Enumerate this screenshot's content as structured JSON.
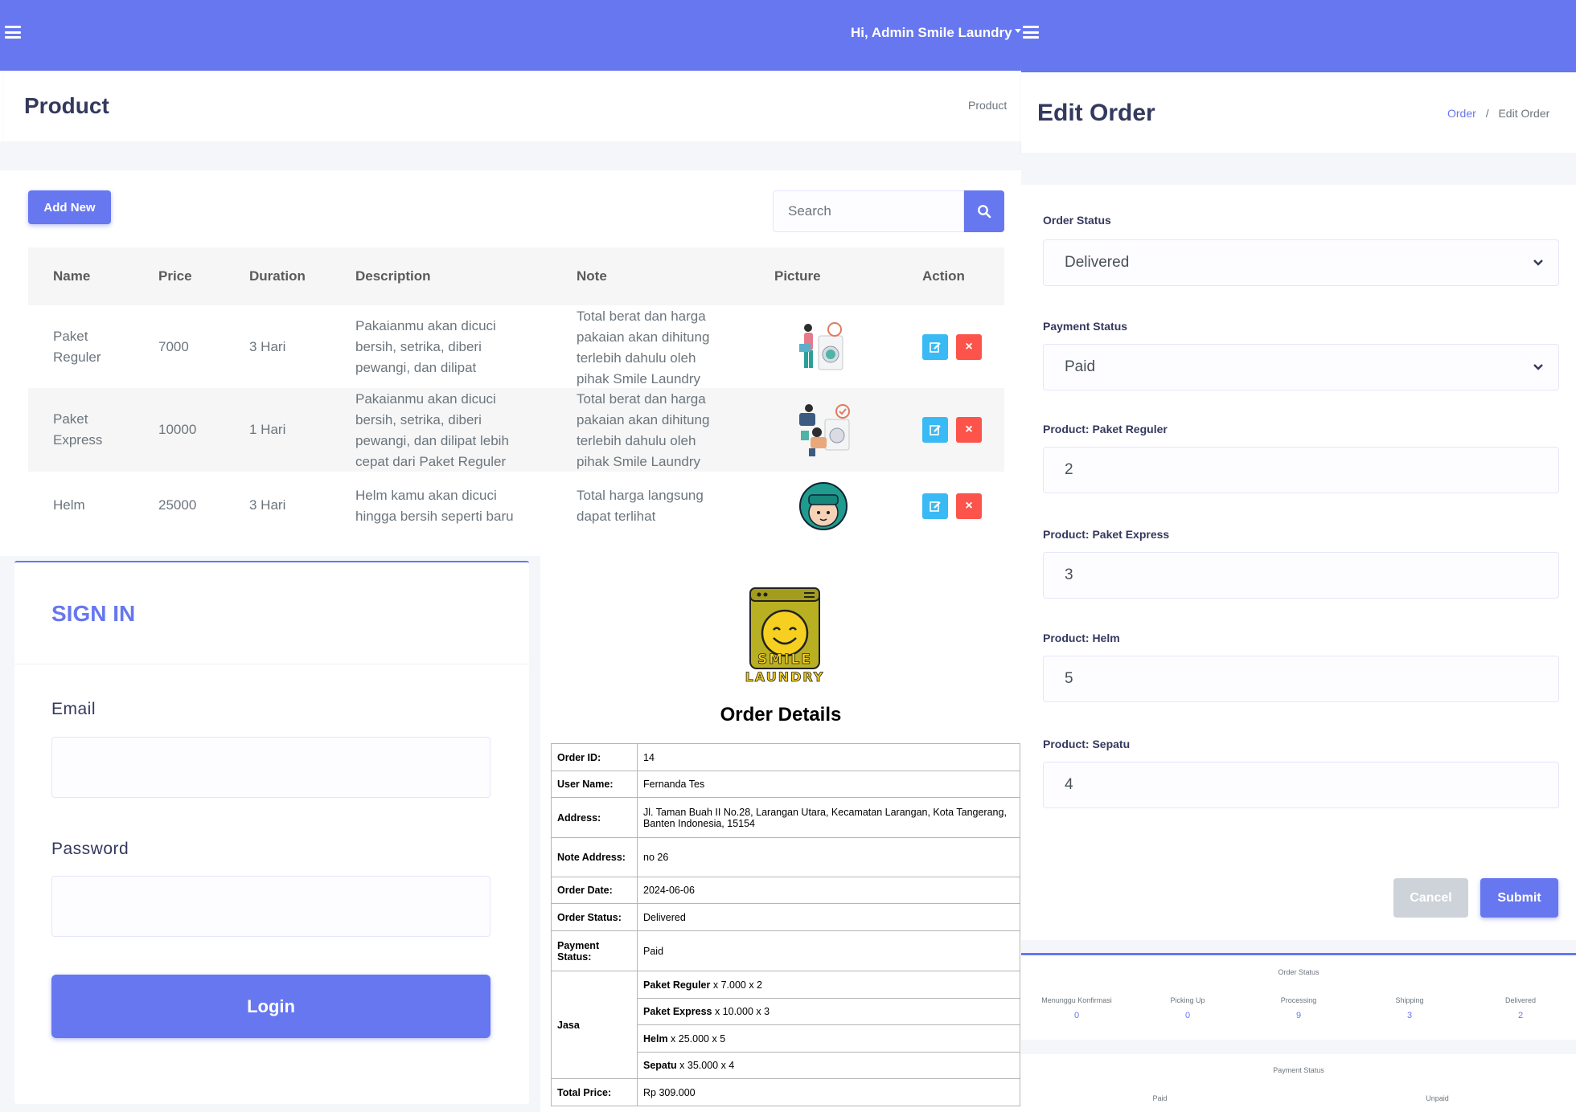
{
  "topbar": {
    "greeting": "Hi, Admin Smile Laundry"
  },
  "product_page": {
    "title": "Product",
    "breadcrumb": "Product",
    "add_new_label": "Add New",
    "search_placeholder": "Search",
    "columns": [
      "Name",
      "Price",
      "Duration",
      "Description",
      "Note",
      "Picture",
      "Action"
    ],
    "rows": [
      {
        "name": [
          "Paket",
          "Reguler"
        ],
        "price": "7000",
        "duration": "3 Hari",
        "description": [
          "Pakaianmu akan dicuci",
          "bersih, setrika, diberi",
          "pewangi, dan dilipat"
        ],
        "note": [
          "Total berat dan harga",
          "pakaian akan dihitung",
          "terlebih dahulu oleh",
          "pihak Smile Laundry"
        ],
        "picture": "laundry-person-illustration"
      },
      {
        "name": [
          "Paket",
          "Express"
        ],
        "price": "10000",
        "duration": "1 Hari",
        "description": [
          "Pakaianmu akan dicuci",
          "bersih, setrika, diberi",
          "pewangi, dan dilipat lebih",
          "cepat dari Paket Reguler"
        ],
        "note": [
          "Total berat dan harga",
          "pakaian akan dihitung",
          "terlebih dahulu oleh",
          "pihak Smile Laundry"
        ],
        "picture": "express-laundry-illustration"
      },
      {
        "name": [
          "Helm"
        ],
        "price": "25000",
        "duration": "3 Hari",
        "description": [
          "Helm kamu akan dicuci",
          "hingga bersih seperti baru"
        ],
        "note": [
          "Total harga langsung",
          "dapat terlihat"
        ],
        "picture": "helmet-illustration"
      }
    ]
  },
  "edit_order": {
    "title": "Edit Order",
    "breadcrumb_parent": "Order",
    "breadcrumb_sep": "/",
    "breadcrumb_current": "Edit Order",
    "fields": [
      {
        "label": "Order Status",
        "value": "Delivered",
        "type": "select"
      },
      {
        "label": "Payment Status",
        "value": "Paid",
        "type": "select"
      },
      {
        "label": "Product: Paket Reguler",
        "value": "2",
        "type": "input"
      },
      {
        "label": "Product: Paket Express",
        "value": "3",
        "type": "input"
      },
      {
        "label": "Product: Helm",
        "value": "5",
        "type": "input"
      },
      {
        "label": "Product: Sepatu",
        "value": "4",
        "type": "input"
      }
    ],
    "cancel_label": "Cancel",
    "submit_label": "Submit"
  },
  "stats": {
    "order_status_title": "Order Status",
    "items": [
      {
        "label": "Menunggu Konfirmasi",
        "value": "0"
      },
      {
        "label": "Picking Up",
        "value": "0"
      },
      {
        "label": "Processing",
        "value": "9"
      },
      {
        "label": "Shipping",
        "value": "3"
      },
      {
        "label": "Delivered",
        "value": "2"
      }
    ],
    "payment_status_title": "Payment Status",
    "payment_items": [
      {
        "label": "Paid"
      },
      {
        "label": "Unpaid"
      }
    ]
  },
  "signin": {
    "title": "SIGN IN",
    "email_label": "Email",
    "password_label": "Password",
    "login_label": "Login"
  },
  "order_details": {
    "logo_text_top": "SMILE",
    "logo_text_bottom": "LAUNDRY",
    "title": "Order Details",
    "rows": [
      {
        "k": "Order ID:",
        "v": "14"
      },
      {
        "k": "User Name:",
        "v": "Fernanda Tes"
      },
      {
        "k": "Address:",
        "v": "Jl. Taman Buah II No.28, Larangan Utara, Kecamatan Larangan, Kota Tangerang, Banten Indonesia, 15154"
      },
      {
        "k": "Note Address:",
        "v": "no 26"
      },
      {
        "k": "Order Date:",
        "v": "2024-06-06"
      },
      {
        "k": "Order Status:",
        "v": "Delivered"
      },
      {
        "k": "Payment Status:",
        "v": "Paid"
      }
    ],
    "jasa_label": "Jasa",
    "jasa": [
      {
        "name": "Paket Reguler",
        "detail": " x 7.000 x 2"
      },
      {
        "name": "Paket Express",
        "detail": " x 10.000 x 3"
      },
      {
        "name": "Helm",
        "detail": " x 25.000 x 5"
      },
      {
        "name": "Sepatu",
        "detail": " x 35.000 x 4"
      }
    ],
    "total_label": "Total Price:",
    "total_value": "Rp 309.000"
  },
  "colors": {
    "primary": "#6777ef",
    "info": "#3abaf4",
    "danger": "#fc544b"
  }
}
